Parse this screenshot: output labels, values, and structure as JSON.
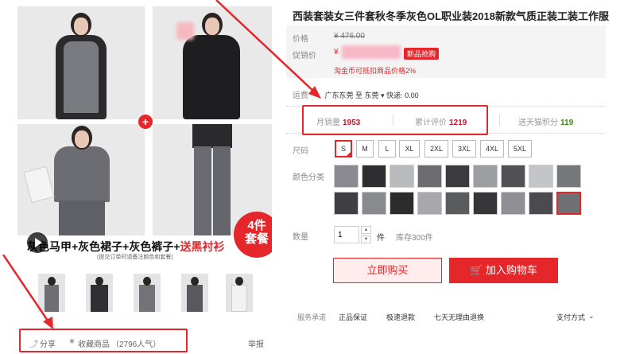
{
  "gallery": {
    "caption_main": "灰色马甲+灰色裙子+灰色裤子+",
    "caption_red": "送黑衬衫",
    "caption_sub": "(提交订单时请备注颜色和套餐)",
    "promo_line1": "4件",
    "promo_line2": "套餐",
    "plus_symbol": "+"
  },
  "share": {
    "share_label": "分享",
    "favorite_label": "收藏商品",
    "favorite_count": "（2796人气）",
    "report_label": "举报"
  },
  "product": {
    "title": "西装套装女三件套秋冬季灰色OL职业装2018新款气质正装工装工作服",
    "price_label": "价格",
    "price_value": "¥ 476.00",
    "promo_label": "促销价",
    "promo_currency": "¥",
    "promo_tag": "新品抢购",
    "coin_note": "淘金币可抵扣商品价格2%"
  },
  "shipping": {
    "label": "运费",
    "text": "广东东莞 至 东莞",
    "dropdown_icon": "chevron-down-icon",
    "express": "快递: 0.00"
  },
  "stats": {
    "monthly_label": "月销量",
    "monthly_value": "1953",
    "reviews_label": "累计评价",
    "reviews_value": "1219",
    "points_label": "送天猫积分",
    "points_value": "119"
  },
  "sizes": {
    "label": "尺码",
    "options": [
      "S",
      "M",
      "L",
      "XL",
      "2XL",
      "3XL",
      "4XL",
      "5XL"
    ],
    "selected": "S"
  },
  "colors": {
    "label": "颜色分类"
  },
  "quantity": {
    "label": "数量",
    "value": "1",
    "unit": "件",
    "stock": "库存300件"
  },
  "actions": {
    "buy_now": "立即购买",
    "add_cart": "加入购物车",
    "cart_icon": "cart-icon"
  },
  "service": {
    "label": "服务承诺",
    "items": [
      "正品保证",
      "极速退款",
      "七天无理由退换"
    ],
    "payment": "支付方式"
  },
  "accent_color": "#e5262b"
}
